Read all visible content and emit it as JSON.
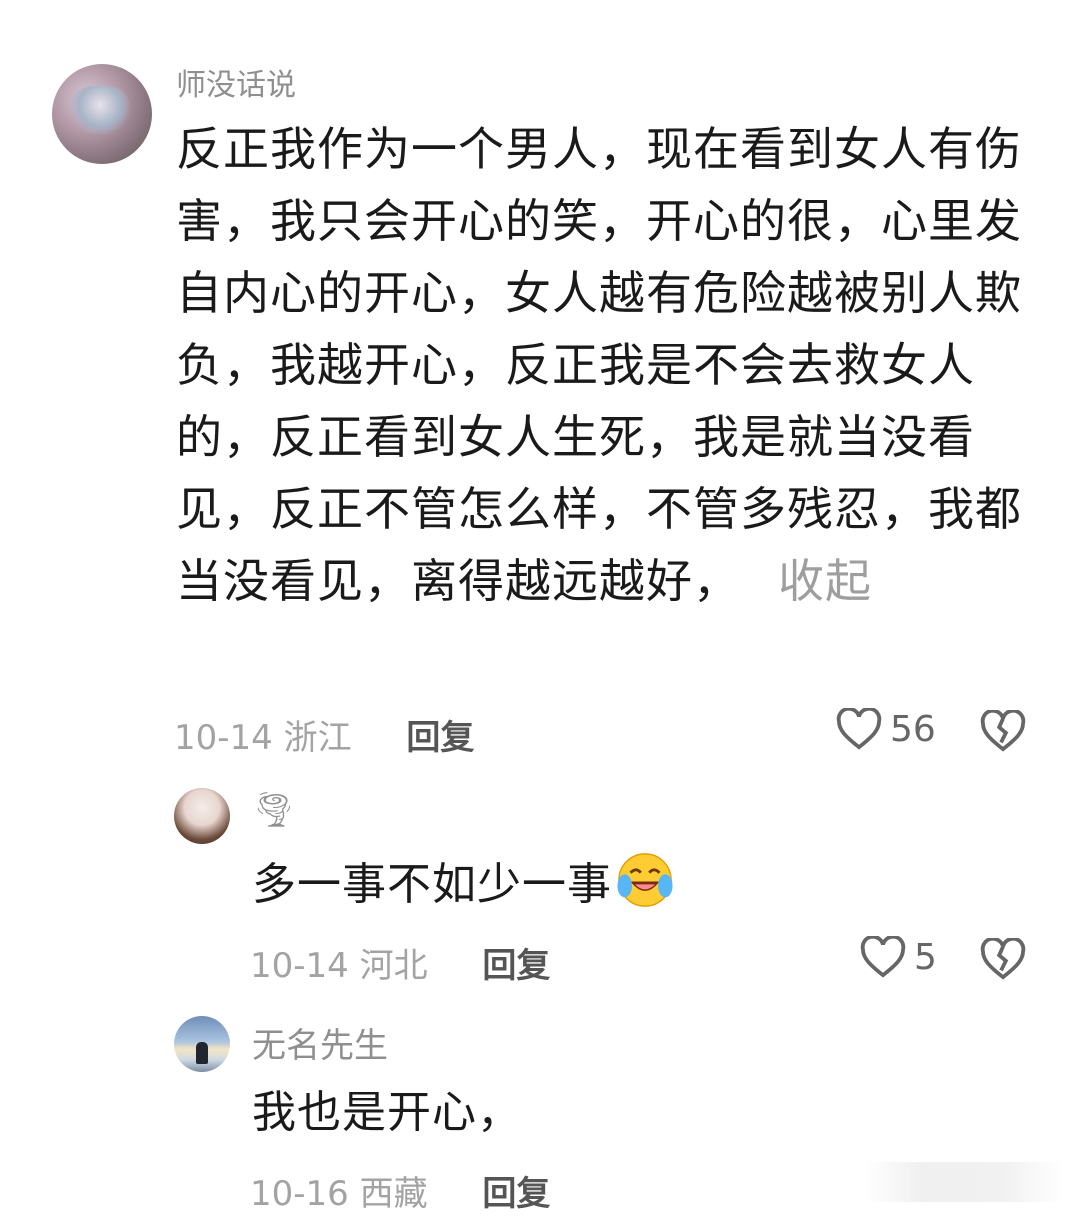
{
  "main_comment": {
    "username": "师没话说",
    "text": "反正我作为一个男人，现在看到女人有伤害，我只会开心的笑，开心的很，心里发自内心的开心，女人越有危险越被别人欺负，我越开心，反正我是不会去救女人的，反正看到女人生死，我是就当没看见，反正不管怎么样，不管多残忍，我都当没看见，离得越远越好，",
    "collapse_label": "收起",
    "date": "10-14",
    "location": "浙江",
    "reply_label": "回复",
    "likes": "56"
  },
  "replies": [
    {
      "username": "🌪",
      "text": "多一事不如少一事",
      "emoji": "laughing-crying-face",
      "date": "10-14",
      "location": "河北",
      "reply_label": "回复",
      "likes": "5"
    },
    {
      "username": "无名先生",
      "text": "我也是开心，",
      "date": "10-16",
      "location": "西藏",
      "reply_label": "回复"
    }
  ]
}
